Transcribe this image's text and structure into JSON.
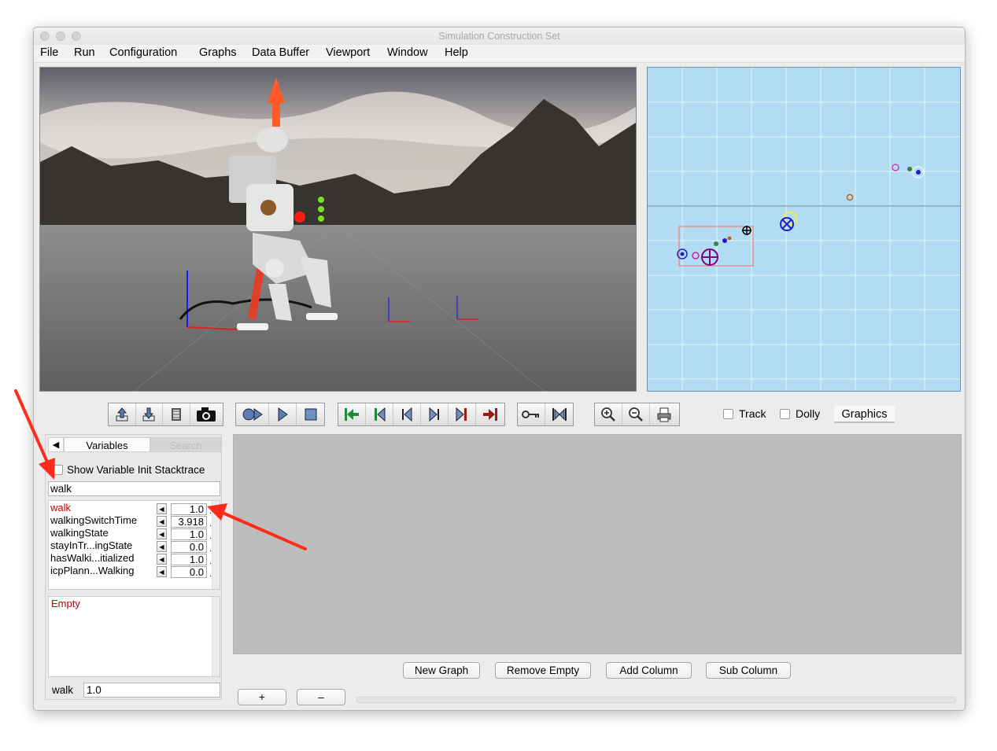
{
  "window": {
    "title": "Simulation Construction Set"
  },
  "menu": [
    "File",
    "Run",
    "Configuration",
    "Graphs",
    "Data Buffer",
    "Viewport",
    "Window",
    "Help"
  ],
  "toolbar": {
    "groups": [
      [
        "export-icon",
        "import-icon",
        "film-icon",
        "camera-icon"
      ],
      [
        "simulate-icon",
        "play-icon",
        "stop-icon"
      ],
      [
        "goto-in-point-icon",
        "step-to-in-point-icon",
        "step-backward-icon",
        "step-forward-icon",
        "step-to-out-point-icon",
        "goto-out-point-icon"
      ],
      [
        "key-icon",
        "key-jump-icon"
      ],
      [
        "zoom-in-icon",
        "zoom-out-icon",
        "print-icon"
      ]
    ],
    "track_label": "Track",
    "dolly_label": "Dolly",
    "graphics_tab": "Graphics"
  },
  "variables_panel": {
    "tab_variables": "Variables",
    "tab_search": "Search",
    "stacktrace_label": "Show Variable Init Stacktrace",
    "search_value": "walk",
    "rows": [
      {
        "name": "walk",
        "value": "1.0",
        "highlight": true
      },
      {
        "name": "walkingSwitchTime",
        "value": "3.918",
        "highlight": false
      },
      {
        "name": "walkingState",
        "value": "1.0",
        "highlight": false
      },
      {
        "name": "stayInTr...ingState",
        "value": "0.0",
        "highlight": false
      },
      {
        "name": "hasWalki...itialized",
        "value": "1.0",
        "highlight": false
      },
      {
        "name": "icpPlann...Walking",
        "value": "0.0",
        "highlight": false
      }
    ],
    "empty_text": "Empty",
    "selected_name": "walk",
    "selected_value": "1.0"
  },
  "graph_buttons": {
    "new_graph": "New Graph",
    "remove_empty": "Remove Empty",
    "add_column": "Add Column",
    "sub_column": "Sub Column",
    "plus": "+",
    "minus": "–"
  },
  "colors": {
    "annotation_arrow": "#ff2a1a",
    "highlight_var": "#c00000",
    "overhead_bg": "#b1dcf3"
  }
}
